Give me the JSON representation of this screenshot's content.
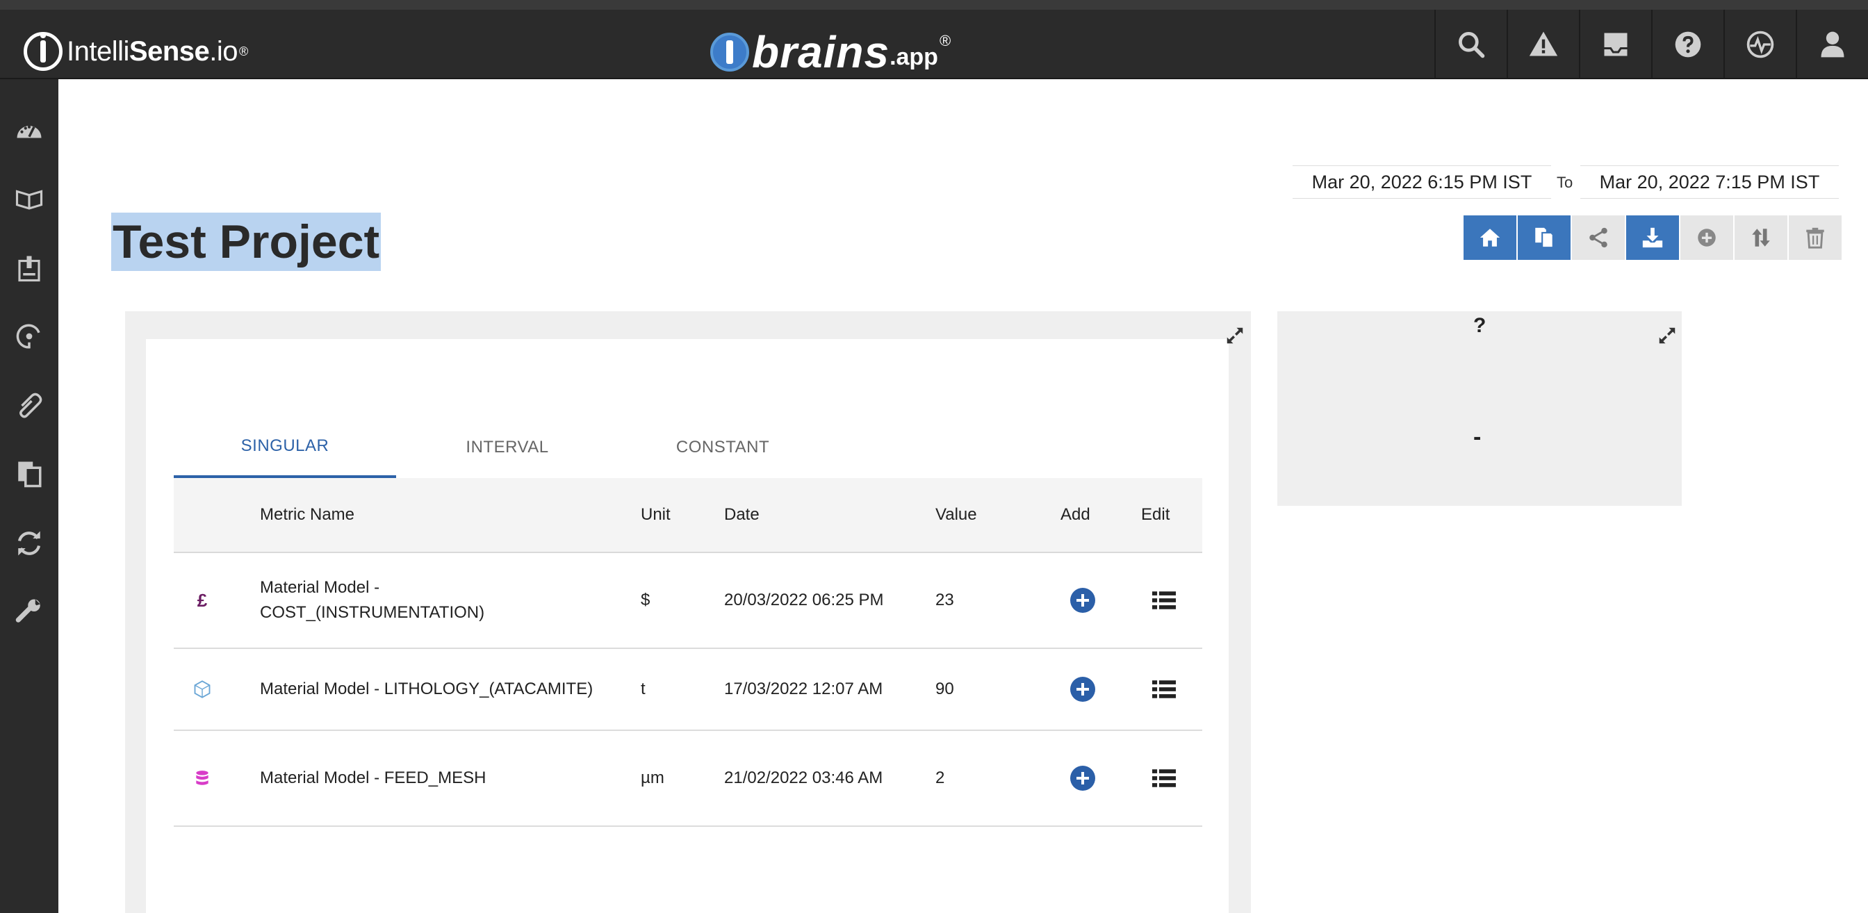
{
  "header": {
    "brand_left_prefix": "Intelli",
    "brand_left_bold": "Sense",
    "brand_left_suffix": ".io",
    "brand_center": "brains",
    "brand_center_suffix": ".app",
    "registered": "®",
    "icons": [
      "search-icon",
      "alert-icon",
      "inbox-icon",
      "help-icon",
      "monitor-icon",
      "user-icon"
    ]
  },
  "sidebar": {
    "icons": [
      "dashboard-icon",
      "book-icon",
      "report-icon",
      "gauge-icon",
      "attachment-icon",
      "files-icon",
      "refresh-icon",
      "wrench-icon"
    ]
  },
  "date_range": {
    "from": "Mar 20, 2022 6:15 PM IST",
    "to_label": "To",
    "to": "Mar 20, 2022 7:15 PM IST"
  },
  "page": {
    "title": "Test Project"
  },
  "toolbar": {
    "buttons": [
      "home-icon",
      "copy-icon",
      "share-icon",
      "download-icon",
      "add-circle-icon",
      "sort-icon",
      "trash-icon"
    ]
  },
  "tabs": [
    {
      "label": "SINGULAR",
      "active": true
    },
    {
      "label": "INTERVAL",
      "active": false
    },
    {
      "label": "CONSTANT",
      "active": false
    }
  ],
  "table": {
    "columns": [
      "Metric Name",
      "Unit",
      "Date",
      "Value",
      "Add",
      "Edit"
    ],
    "rows": [
      {
        "icon": "pound-icon",
        "metric": "Material Model - COST_(INSTRUMENTATION)",
        "unit": "$",
        "date": "20/03/2022 06:25 PM",
        "value": "23"
      },
      {
        "icon": "crystal-icon",
        "metric": "Material Model - LITHOLOGY_(ATACAMITE)",
        "unit": "t",
        "date": "17/03/2022 12:07 AM",
        "value": "90"
      },
      {
        "icon": "database-icon",
        "metric": "Material Model - FEED_MESH",
        "unit": "µm",
        "date": "21/02/2022 03:46 AM",
        "value": "2"
      }
    ]
  },
  "widget": {
    "help": "?",
    "value": "-"
  },
  "colors": {
    "topbar": "#2b2b2b",
    "accent": "#3b76bc",
    "tab_active": "#2d62a8"
  }
}
